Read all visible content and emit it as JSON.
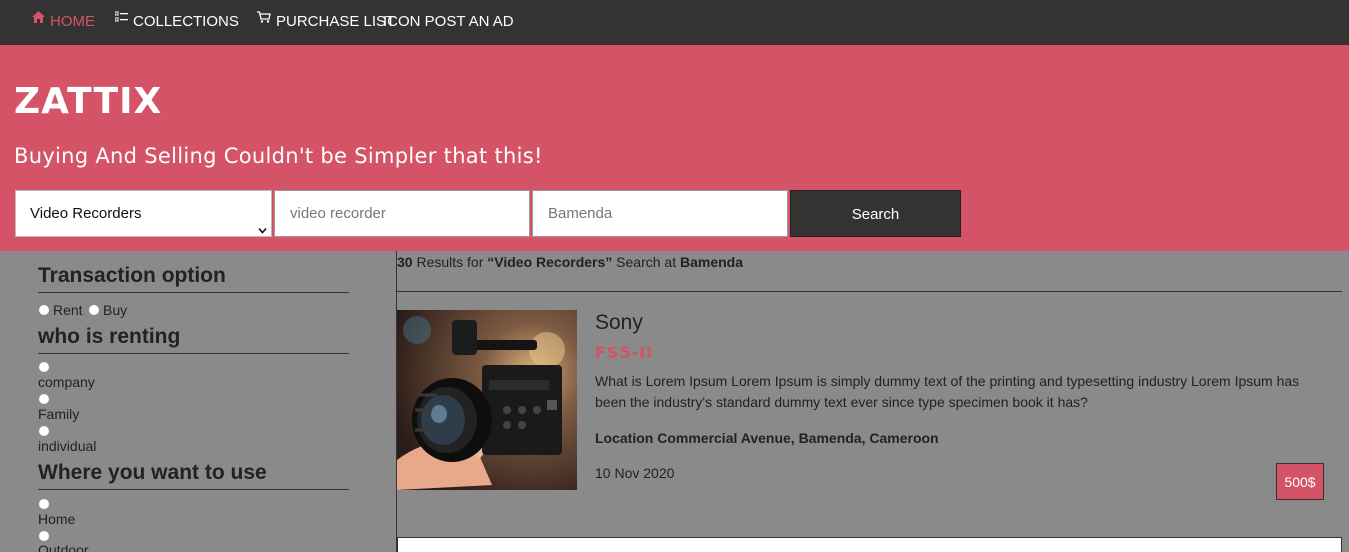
{
  "nav": {
    "items": [
      {
        "label": "HOME",
        "icon": "home-icon",
        "active": true
      },
      {
        "label": "COLLECTIONS",
        "icon": "list-icon"
      },
      {
        "label": "PURCHASE LIST",
        "icon": "cart-icon"
      },
      {
        "label": "ICON POST AN AD"
      }
    ]
  },
  "hero": {
    "brand": "ZATTIX",
    "tagline": "Buying And Selling Couldn't be Simpler that this!"
  },
  "search": {
    "category_value": "Video Recorders",
    "query_value": "video recorder",
    "location_value": "Bamenda",
    "button_label": "Search"
  },
  "sidebar": {
    "transaction": {
      "title": "Transaction option",
      "options": [
        "Rent",
        "Buy"
      ]
    },
    "renter": {
      "title": "who is renting",
      "options": [
        "company",
        "Family",
        "individual"
      ]
    },
    "usage": {
      "title": "Where you want to use",
      "options": [
        "Home",
        "Outdoor"
      ]
    }
  },
  "results": {
    "count": "30",
    "text_1": " Results for ",
    "category": "“Video Recorders”",
    "text_2": " Search at ",
    "location": "Bamenda"
  },
  "listing": {
    "brand": "Sony",
    "model": "FS5-II",
    "description": "What is Lorem Ipsum Lorem Ipsum is simply dummy text of the printing and typesetting industry Lorem Ipsum has been the industry's standard dummy text ever since type specimen book it has?",
    "location": "Location Commercial Avenue, Bamenda, Cameroon",
    "date": "10 Nov 2020",
    "price": "500$"
  },
  "colors": {
    "accent": "#d45366",
    "nav_bg": "#333333",
    "page_bg": "#8a8a8a"
  }
}
